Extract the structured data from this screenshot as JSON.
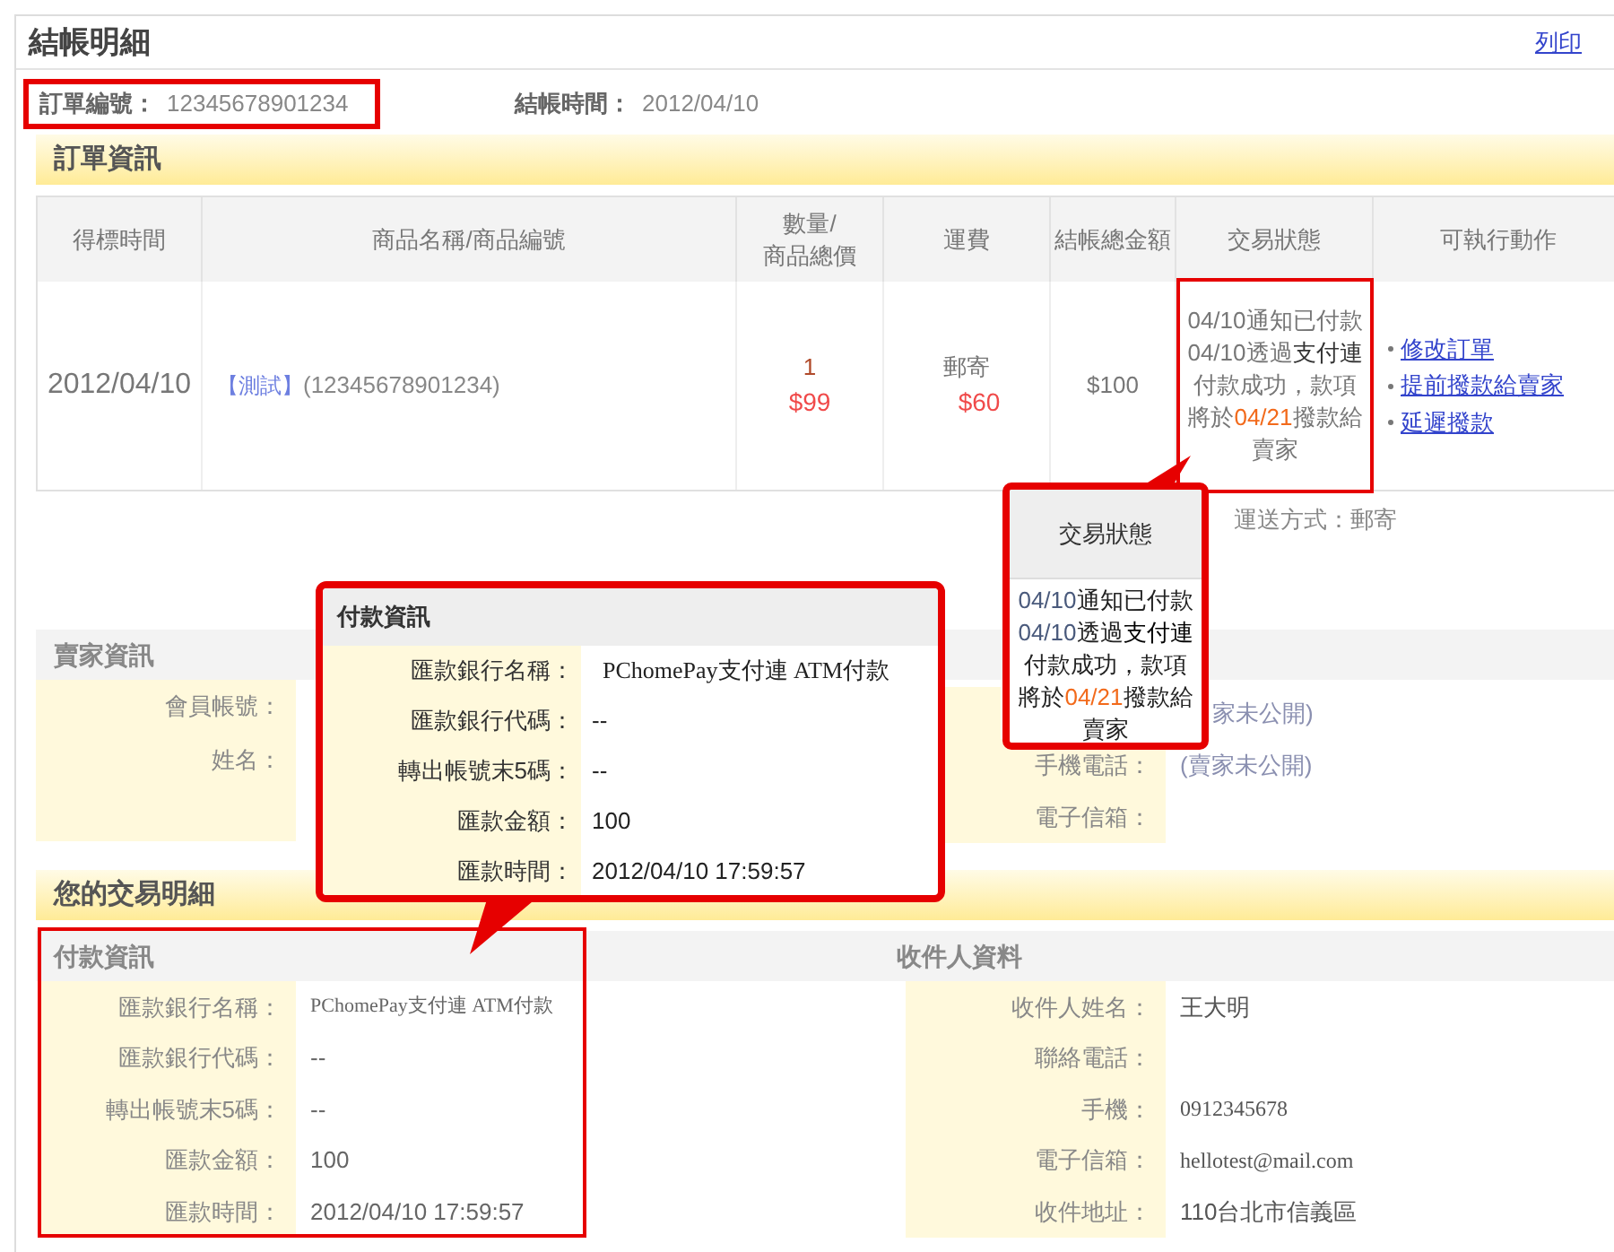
{
  "page": {
    "title": "結帳明細",
    "print_link": "列印"
  },
  "order_meta": [
    {
      "label": "訂單編號：",
      "value": "12345678901234",
      "highlighted": true
    },
    {
      "label": "結帳時間：",
      "value": "2012/04/10",
      "highlighted": false
    }
  ],
  "order_section": {
    "title": "訂單資訊",
    "columns": [
      [
        "得標時間"
      ],
      [
        "商品名稱/商品編號"
      ],
      [
        "數量/",
        "商品總價"
      ],
      [
        "運費"
      ],
      [
        "結帳總金額"
      ],
      [
        "交易狀態"
      ],
      [
        "可執行動作"
      ]
    ],
    "row": {
      "date": "2012/04/10",
      "product_tag": "【測試】",
      "product_code": "(12345678901234)",
      "quantity": "1",
      "total": "$99",
      "shipping_method": "郵寄",
      "shipping_fee": "$60",
      "amount": "$100",
      "status_highlighted": true,
      "status": [
        [
          {
            "text": "04/10",
            "kind": "date"
          },
          {
            "text": "通知已付款",
            "kind": "plain"
          }
        ],
        [
          {
            "text": "04/10",
            "kind": "date"
          },
          {
            "text": "透過",
            "kind": "plain"
          },
          {
            "text": "支付連",
            "kind": "emph"
          }
        ],
        [
          {
            "text": "付款成功，款項",
            "kind": "plain"
          }
        ],
        [
          {
            "text": "將於",
            "kind": "plain"
          },
          {
            "text": "04/21",
            "kind": "due"
          },
          {
            "text": "撥款給",
            "kind": "plain"
          }
        ],
        [
          {
            "text": "賣家",
            "kind": "plain"
          }
        ]
      ],
      "actions": [
        "修改訂單",
        "提前撥款給賣家",
        "延遲撥款"
      ]
    },
    "shipping_note": "運送方式：郵寄"
  },
  "status_callout": {
    "title": "交易狀態",
    "lines": [
      [
        {
          "text": "04/10",
          "kind": "date"
        },
        {
          "text": "通知已付款",
          "kind": "plain"
        }
      ],
      [
        {
          "text": "04/10",
          "kind": "date"
        },
        {
          "text": "透過",
          "kind": "plain"
        },
        {
          "text": "支付連",
          "kind": "emph"
        }
      ],
      [
        {
          "text": "付款成功，款項",
          "kind": "plain"
        }
      ],
      [
        {
          "text": "將於",
          "kind": "plain"
        },
        {
          "text": "04/21",
          "kind": "due"
        },
        {
          "text": "撥款給",
          "kind": "plain"
        }
      ],
      [
        {
          "text": "賣家",
          "kind": "plain"
        }
      ]
    ]
  },
  "seller_section": {
    "title": "賣家資訊",
    "left_rows": [
      {
        "label": "會員帳號："
      },
      {
        "label": "姓名："
      }
    ],
    "right_rows": [
      {
        "value": "家未公開)"
      },
      {
        "label": "手機電話：",
        "value": "(賣家未公開)"
      },
      {
        "label": "電子信箱："
      }
    ]
  },
  "payment_callout": {
    "title": "付款資訊",
    "rows": [
      {
        "label": "匯款銀行名稱：",
        "value": "PChomePay支付連 ATM付款",
        "kind": "serif"
      },
      {
        "label": "匯款銀行代碼：",
        "value": "--",
        "kind": "plain"
      },
      {
        "label": "轉出帳號末5碼：",
        "value": "--",
        "kind": "plain"
      },
      {
        "label": "匯款金額：",
        "value": "100",
        "kind": "plain"
      },
      {
        "label": "匯款時間：",
        "value": "2012/04/10 17:59:57",
        "kind": "plain"
      }
    ]
  },
  "transaction_section": {
    "title": "您的交易明細",
    "payment": {
      "title": "付款資訊",
      "highlighted": true,
      "rows": [
        {
          "label": "匯款銀行名稱：",
          "value": "PChomePay支付連 ATM付款",
          "kind": "serif"
        },
        {
          "label": "匯款銀行代碼：",
          "value": "--",
          "kind": "plain"
        },
        {
          "label": "轉出帳號末5碼：",
          "value": "--",
          "kind": "plain"
        },
        {
          "label": "匯款金額：",
          "value": "100",
          "kind": "plain"
        },
        {
          "label": "匯款時間：",
          "value": "2012/04/10 17:59:57",
          "kind": "plain"
        }
      ]
    },
    "recipient": {
      "title": "收件人資料",
      "rows": [
        {
          "label": "收件人姓名：",
          "value": "王大明",
          "kind": "plain"
        },
        {
          "label": "聯絡電話：",
          "kind": "plain"
        },
        {
          "label": "手機：",
          "value": "0912345678",
          "kind": "serif"
        },
        {
          "label": "電子信箱：",
          "value": "hellotest@mail.com",
          "kind": "serif"
        },
        {
          "label": "收件地址：",
          "value": "110台北市信義區",
          "kind": "plain"
        }
      ]
    }
  }
}
